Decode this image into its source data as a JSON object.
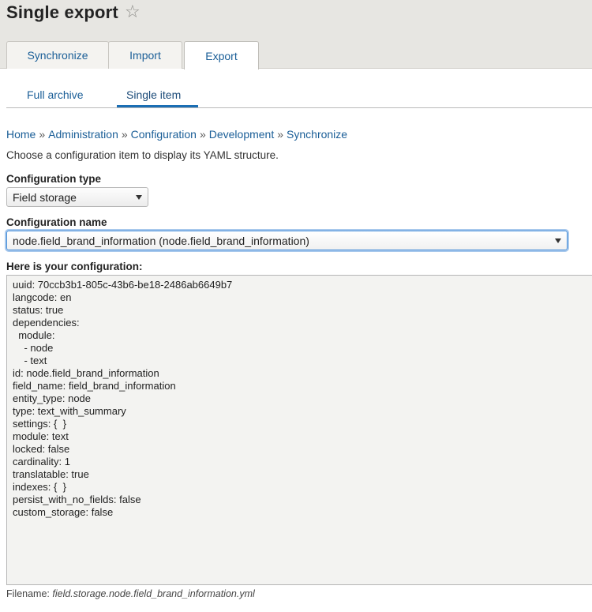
{
  "header": {
    "title": "Single export",
    "star_icon": "☆"
  },
  "tabs": [
    {
      "label": "Synchronize"
    },
    {
      "label": "Import"
    },
    {
      "label": "Export"
    }
  ],
  "subtabs": [
    {
      "label": "Full archive"
    },
    {
      "label": "Single item"
    }
  ],
  "breadcrumb": {
    "items": [
      "Home",
      "Administration",
      "Configuration",
      "Development",
      "Synchronize"
    ],
    "separator": "»"
  },
  "intro_text": "Choose a configuration item to display its YAML structure.",
  "config_type": {
    "label": "Configuration type",
    "value": "Field storage"
  },
  "config_name": {
    "label": "Configuration name",
    "value": "node.field_brand_information (node.field_brand_information)"
  },
  "output": {
    "label": "Here is your configuration:",
    "yaml": "uuid: 70ccb3b1-805c-43b6-be18-2486ab6649b7\nlangcode: en\nstatus: true\ndependencies:\n  module:\n    - node\n    - text\nid: node.field_brand_information\nfield_name: field_brand_information\nentity_type: node\ntype: text_with_summary\nsettings: {  }\nmodule: text\nlocked: false\ncardinality: 1\ntranslatable: true\nindexes: {  }\npersist_with_no_fields: false\ncustom_storage: false"
  },
  "filename": {
    "label": "Filename:",
    "value": "field.storage.node.field_brand_information.yml"
  },
  "colors": {
    "link": "#1a5e97",
    "header_bg": "#e7e6e2",
    "focus": "#4a90d9"
  }
}
